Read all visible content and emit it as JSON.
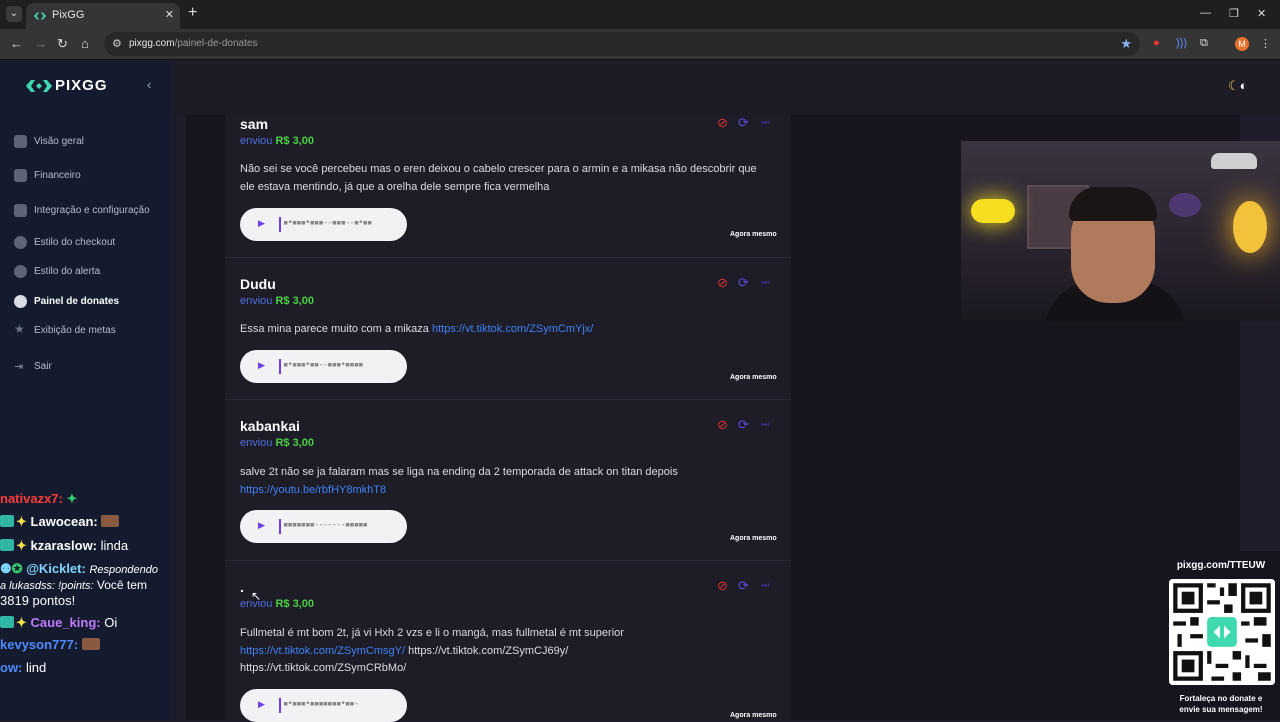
{
  "browser": {
    "tab_title": "PixGG",
    "url_domain": "pixgg.com",
    "url_path": "/painel-de-donates",
    "profile_initial": "M",
    "window_controls": [
      "minimize-icon",
      "restore-icon",
      "close-icon"
    ]
  },
  "sidebar": {
    "brand": "PIXGG",
    "items": [
      {
        "label": "Visão geral",
        "icon": "home-icon",
        "active": false
      },
      {
        "label": "Financeiro",
        "icon": "wallet-icon",
        "active": false
      },
      {
        "label": "Integração e configuração",
        "icon": "settings-icon",
        "active": false
      },
      {
        "label": "Estilo do checkout",
        "icon": "palette-icon",
        "active": false
      },
      {
        "label": "Estilo do alerta",
        "icon": "palette-icon",
        "active": false
      },
      {
        "label": "Painel de donates",
        "icon": "users-icon",
        "active": true
      },
      {
        "label": "Exibição de metas",
        "icon": "star-icon",
        "active": false
      },
      {
        "label": "Sair",
        "icon": "logout-icon",
        "active": false
      }
    ]
  },
  "donations": [
    {
      "name": "sam",
      "sent_word": "enviou",
      "amount": "R$ 3,00",
      "message": "Não sei se você percebeu mas o eren deixou o cabelo crescer para o armin e a mikasa não descobrir que ele estava mentindo, já que a orelha dele sempre fica vermelha",
      "links": [],
      "time": "Agora mesmo"
    },
    {
      "name": "Dudu",
      "sent_word": "enviou",
      "amount": "R$ 3,00",
      "message": "Essa mina parece muito com a mikaza ",
      "links": [
        "https://vt.tiktok.com/ZSymCmYjx/"
      ],
      "time": "Agora mesmo"
    },
    {
      "name": "kabankai",
      "sent_word": "enviou",
      "amount": "R$ 3,00",
      "message": "salve 2t não se ja falaram mas se liga na ending da 2 temporada de attack on titan depois ",
      "links": [
        "https://youtu.be/rbfHY8mkhT8"
      ],
      "time": "Agora mesmo"
    },
    {
      "name": ".",
      "sent_word": "enviou",
      "amount": "R$ 3,00",
      "message": "Fullmetal é mt bom 2t, já vi Hxh 2 vzs e li o mangá, mas fullmetal é mt superior ",
      "links": [
        "https://vt.tiktok.com/ZSymCmsgY/"
      ],
      "plain_links": [
        "https://vt.tiktok.com/ZSymCJ69y/",
        "https://vt.tiktok.com/ZSymCRbMo/"
      ],
      "time": "Agora mesmo"
    }
  ],
  "chat": [
    {
      "user": "nativazx7:",
      "color": "#ff3b3b",
      "text": ""
    },
    {
      "user": "Lawocean:",
      "color": "#ffffff",
      "text": ""
    },
    {
      "user": "kzaraslow:",
      "color": "#ffffff",
      "text": "linda"
    },
    {
      "user": "@Kicklet:",
      "color": "#7fd6ff",
      "text": "Respondendo"
    },
    {
      "user": "",
      "color": "#ffffff",
      "text": "a lukasdss: !points: Você tem"
    },
    {
      "user": "",
      "color": "#ffffff",
      "text": "3819 pontos!"
    },
    {
      "user": "Caue_king:",
      "color": "#c07bff",
      "text": "Oi"
    },
    {
      "user": "kevyson777:",
      "color": "#4f8bff",
      "text": ""
    },
    {
      "user": "ow:",
      "color": "#4f8bff",
      "text": "lind"
    }
  ],
  "qr_widget": {
    "url": "pixgg.com/TTEUW",
    "caption_line1": "Fortaleça no donate e",
    "caption_line2": "envie sua mensagem!"
  },
  "colors": {
    "accent": "#6c3fe6",
    "amount": "#4ad142",
    "link": "#3e82f5",
    "sidebar_bg": "#141b2e"
  }
}
